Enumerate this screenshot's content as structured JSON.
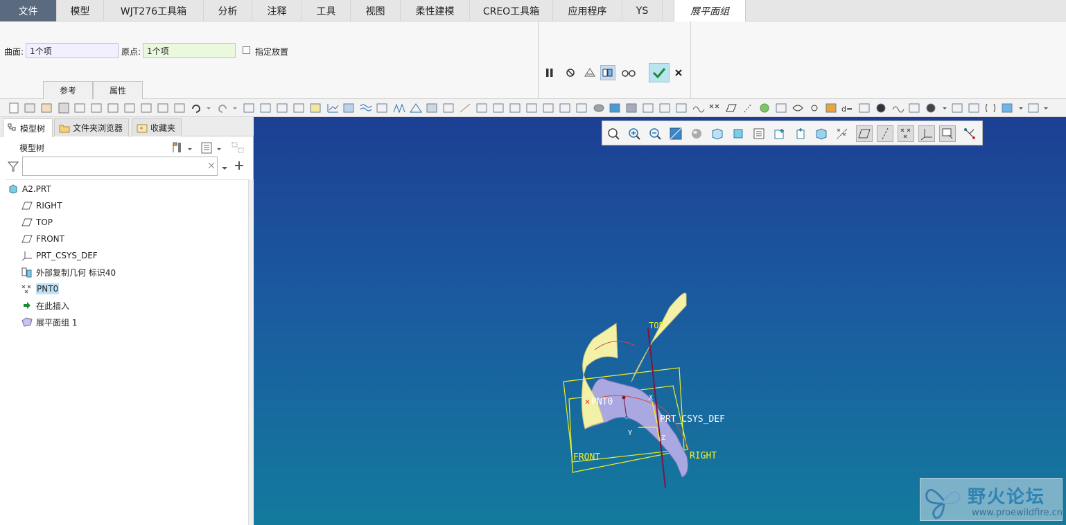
{
  "menubar": {
    "tabs": [
      "文件",
      "模型",
      "WJT276工具箱",
      "分析",
      "注释",
      "工具",
      "视图",
      "柔性建模",
      "CREO工具箱",
      "应用程序",
      "YS",
      "展平面组"
    ]
  },
  "dashboard": {
    "surface_label": "曲面:",
    "surface_value": "1个项",
    "origin_label": "原点:",
    "origin_value": "1个项",
    "placement_label": "指定放置",
    "tab_refs": "参考",
    "tab_props": "属性"
  },
  "left_panel": {
    "tabs": [
      "模型树",
      "文件夹浏览器",
      "收藏夹"
    ],
    "tree_title": "模型树",
    "filter_placeholder": "",
    "tree_items": [
      "A2.PRT",
      "RIGHT",
      "TOP",
      "FRONT",
      "PRT_CSYS_DEF",
      "外部复制几何 标识40",
      "PNT0",
      "在此插入",
      "展平面组 1"
    ]
  },
  "graphics": {
    "labels": {
      "top": "TOP",
      "pnt0": "PNT0",
      "csys": "PRT_CSYS_DEF",
      "front": "FRONT",
      "right": "RIGHT",
      "x": "X",
      "y": "Y",
      "z": "Z"
    },
    "watermark_title": "野火论坛",
    "watermark_url": "www.proewildfire.cn"
  },
  "colors": {
    "accent": "#5a6b7f",
    "datum": "#ffff33",
    "surface": "#f3f0a8",
    "surface_shade": "#a9a8e0"
  }
}
